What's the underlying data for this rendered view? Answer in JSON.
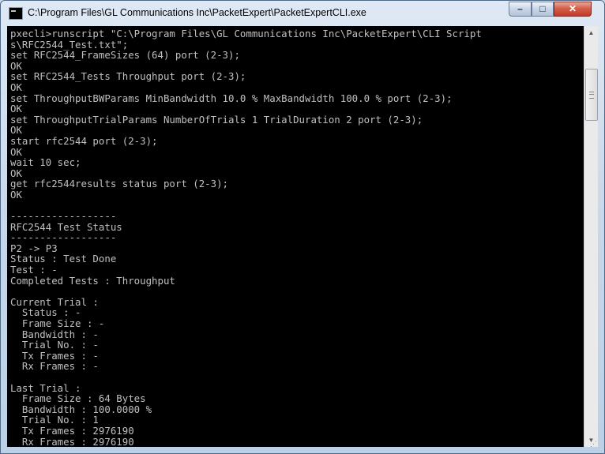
{
  "window": {
    "title": "C:\\Program Files\\GL Communications Inc\\PacketExpert\\PacketExpertCLI.exe",
    "icon": "console-app-icon",
    "controls": {
      "minimize": "–",
      "maximize": "□",
      "close": "✕"
    }
  },
  "console": {
    "background": "#000000",
    "foreground": "#c0c0c0",
    "lines": [
      "pxecli>runscript \"C:\\Program Files\\GL Communications Inc\\PacketExpert\\CLI Script",
      "s\\RFC2544_Test.txt\";",
      "set RFC2544_FrameSizes (64) port (2-3);",
      "OK",
      "set RFC2544_Tests Throughput port (2-3);",
      "OK",
      "set ThroughputBWParams MinBandwidth 10.0 % MaxBandwidth 100.0 % port (2-3);",
      "OK",
      "set ThroughputTrialParams NumberOfTrials 1 TrialDuration 2 port (2-3);",
      "OK",
      "start rfc2544 port (2-3);",
      "OK",
      "wait 10 sec;",
      "OK",
      "get rfc2544results status port (2-3);",
      "OK",
      "",
      "------------------",
      "RFC2544 Test Status",
      "------------------",
      "P2 -> P3",
      "Status : Test Done",
      "Test : -",
      "Completed Tests : Throughput",
      "",
      "Current Trial :",
      "  Status : -",
      "  Frame Size : -",
      "  Bandwidth : -",
      "  Trial No. : -",
      "  Tx Frames : -",
      "  Rx Frames : -",
      "",
      "Last Trial :",
      "  Frame Size : 64 Bytes",
      "  Bandwidth : 100.0000 %",
      "  Trial No. : 1",
      "  Tx Frames : 2976190",
      "  Rx Frames : 2976190"
    ]
  },
  "scrollbar": {
    "up_icon": "▲",
    "down_icon": "▼"
  }
}
